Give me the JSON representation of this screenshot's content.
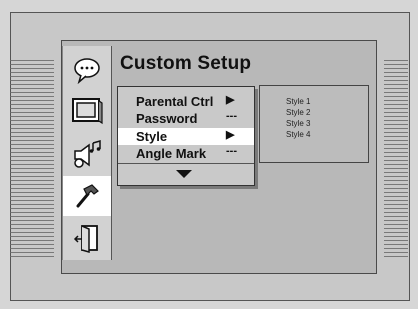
{
  "title": "Custom Setup",
  "icons": [
    {
      "name": "speech-bubble-icon",
      "glyph": "speech"
    },
    {
      "name": "tv-icon",
      "glyph": "tv"
    },
    {
      "name": "speaker-music-icon",
      "glyph": "speaker"
    },
    {
      "name": "hammer-icon",
      "glyph": "hammer"
    },
    {
      "name": "exit-door-icon",
      "glyph": "door"
    }
  ],
  "active_icon_index": 3,
  "menu": {
    "items": [
      {
        "label": "Parental Ctrl",
        "value": "▶"
      },
      {
        "label": "Password",
        "value": "---"
      },
      {
        "label": "Style",
        "value": "▶"
      },
      {
        "label": "Angle Mark",
        "value": "---"
      }
    ],
    "selected_index": 2,
    "more_indicator": "▼"
  },
  "submenu": {
    "items": [
      "Style 1",
      "Style 2",
      "Style 3",
      "Style 4"
    ]
  }
}
